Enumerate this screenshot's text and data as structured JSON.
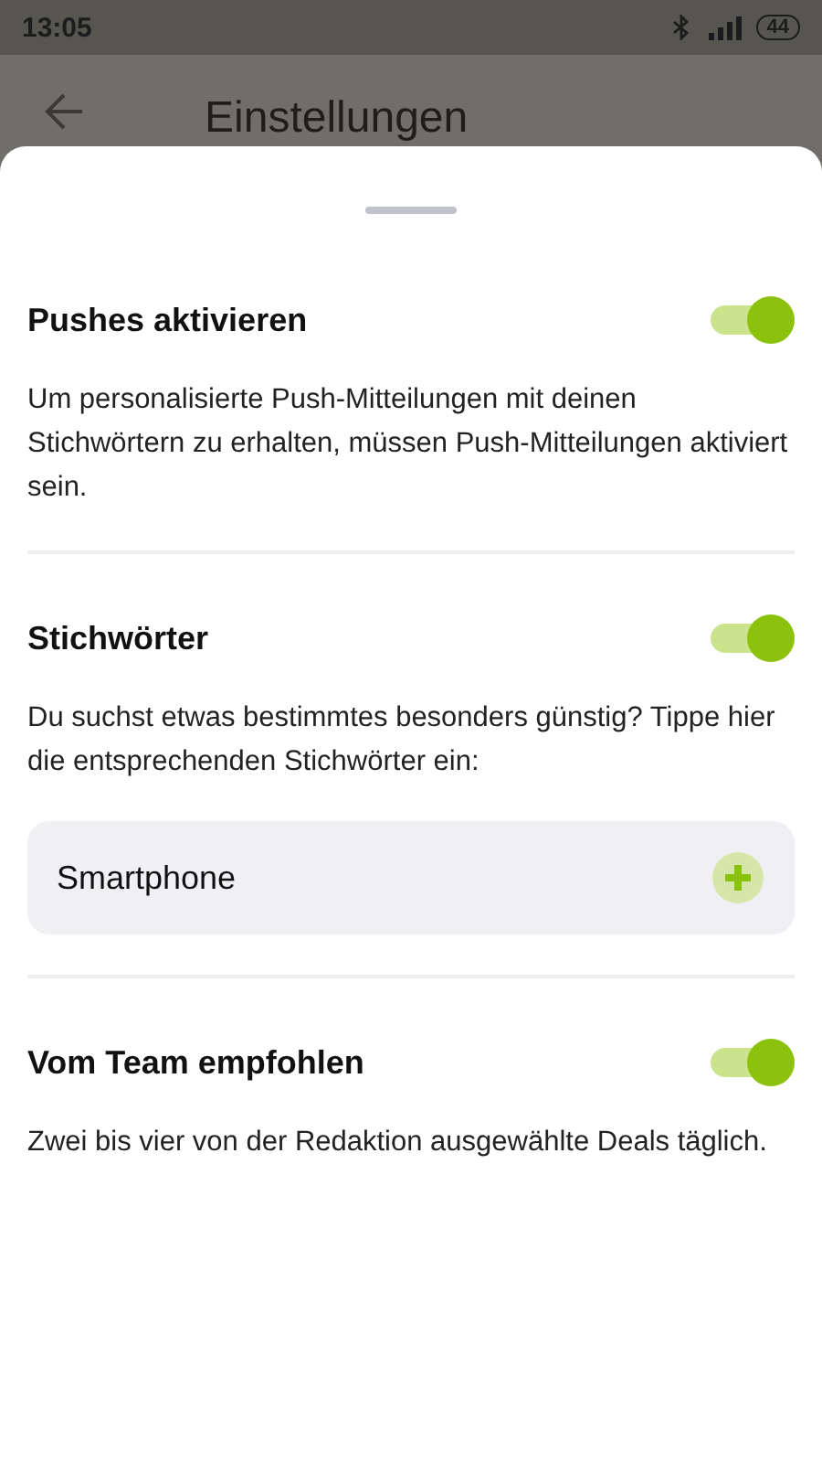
{
  "status_bar": {
    "time": "13:05",
    "battery": "44"
  },
  "header": {
    "title": "Einstellungen"
  },
  "sections": [
    {
      "title": "Pushes aktivieren",
      "on": true,
      "description": "Um personalisierte Push-Mitteilungen mit deinen Stichwörtern zu erhalten, müssen Push-Mitteilungen aktiviert sein."
    },
    {
      "title": "Stichwörter",
      "on": true,
      "description": "Du suchst etwas bestimmtes besonders günstig? Tippe hier die entsprechenden Stichwörter ein:",
      "field": {
        "value": "Smartphone"
      }
    },
    {
      "title": "Vom Team empfohlen",
      "on": true,
      "description": "Zwei bis vier von der Redaktion ausgewählte Deals täglich."
    }
  ]
}
